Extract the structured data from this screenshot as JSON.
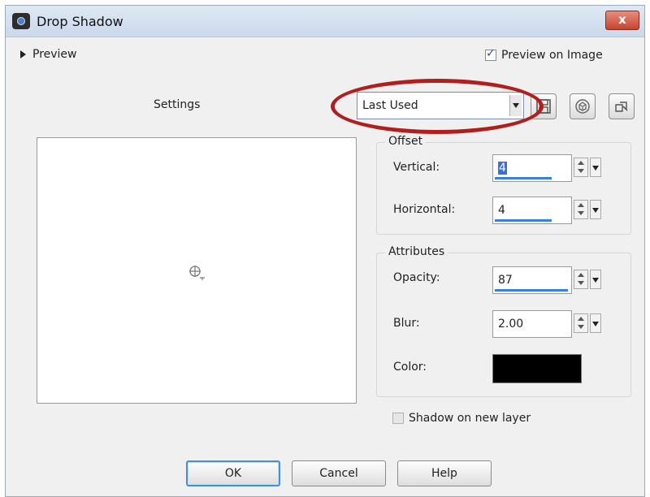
{
  "window": {
    "title": "Drop Shadow",
    "close_glyph": "x"
  },
  "preview": {
    "toggle_label": "Preview",
    "on_image_label": "Preview on Image",
    "on_image_checked": true
  },
  "settings": {
    "label": "Settings",
    "preset_value": "Last Used"
  },
  "icons": {
    "save": "save-icon",
    "reset": "reset-icon",
    "manage": "manage-presets-icon",
    "preview_marker": "crosshair-icon"
  },
  "offset": {
    "title": "Offset",
    "vertical_label": "Vertical:",
    "vertical_value": "4",
    "horizontal_label": "Horizontal:",
    "horizontal_value": "4"
  },
  "attributes": {
    "title": "Attributes",
    "opacity_label": "Opacity:",
    "opacity_value": "87",
    "blur_label": "Blur:",
    "blur_value": "2.00",
    "color_label": "Color:",
    "color_value": "#000000"
  },
  "shadow_layer": {
    "label": "Shadow on new layer",
    "checked": false
  },
  "buttons": {
    "ok": "OK",
    "cancel": "Cancel",
    "help": "Help"
  },
  "colors": {
    "annotation_ellipse": "#b01f1f",
    "accent": "#3b7fd8"
  }
}
